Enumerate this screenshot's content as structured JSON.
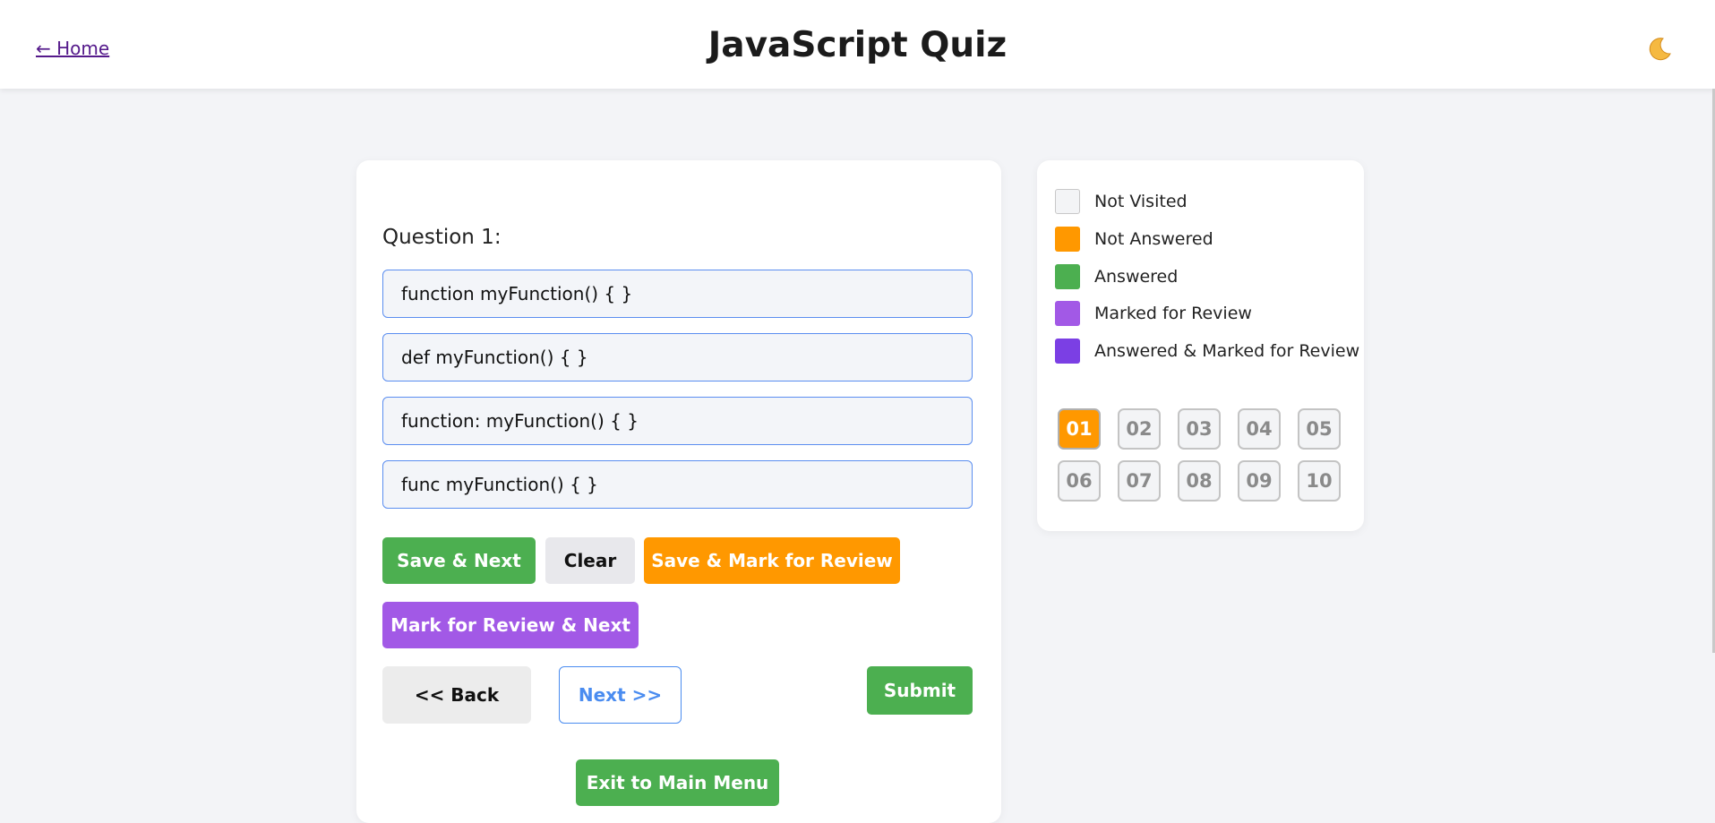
{
  "header": {
    "home_link": "← Home",
    "title": "JavaScript Quiz",
    "theme_icon": "🌙"
  },
  "question": {
    "label": "Question 1:",
    "options": [
      "function myFunction() { }",
      "def myFunction() { }",
      "function: myFunction() { }",
      "func myFunction() { }"
    ]
  },
  "actions": {
    "save_next": "Save & Next",
    "clear": "Clear",
    "save_mark_review": "Save & Mark for Review",
    "mark_review_next": "Mark for Review & Next",
    "back": "<< Back",
    "next": "Next >>",
    "submit": "Submit",
    "exit": "Exit to Main Menu"
  },
  "legend": [
    {
      "label": "Not Visited",
      "color": "#f3f4f6"
    },
    {
      "label": "Not Answered",
      "color": "#ff9800"
    },
    {
      "label": "Answered",
      "color": "#4caf50"
    },
    {
      "label": "Marked for Review",
      "color": "#a259e6"
    },
    {
      "label": "Answered & Marked for Review",
      "color": "#7b3fe4"
    }
  ],
  "question_numbers": [
    "01",
    "02",
    "03",
    "04",
    "05",
    "06",
    "07",
    "08",
    "09",
    "10"
  ],
  "current_question": "01"
}
